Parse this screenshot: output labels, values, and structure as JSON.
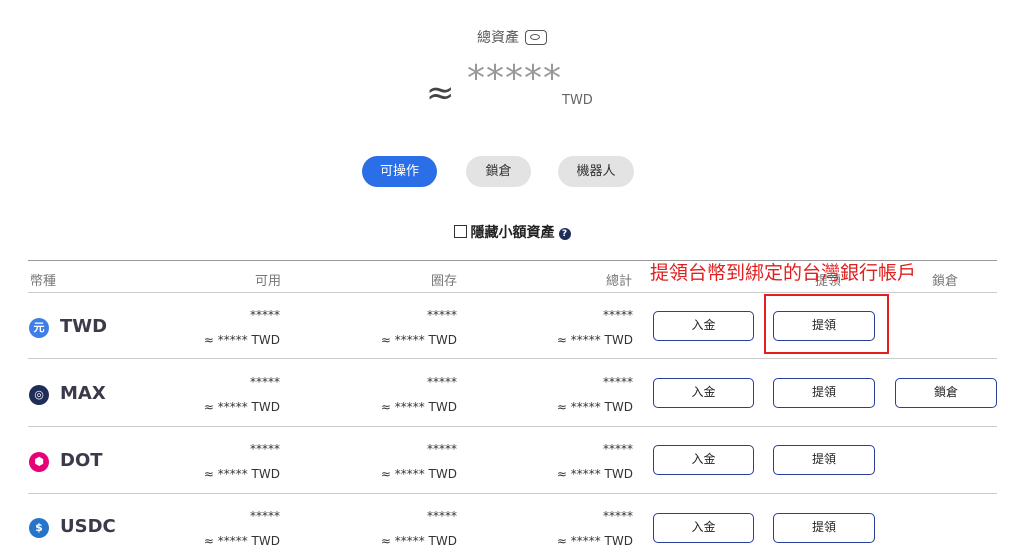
{
  "summary": {
    "total_label": "總資產",
    "approx": "≈",
    "total_value": "*****",
    "currency": "TWD"
  },
  "tabs": [
    {
      "label": "可操作",
      "active": true
    },
    {
      "label": "鎖倉",
      "active": false
    },
    {
      "label": "機器人",
      "active": false
    }
  ],
  "filter": {
    "hide_small_label": "隱藏小額資產",
    "help_glyph": "?"
  },
  "table": {
    "headers": {
      "currency": "幣種",
      "available": "可用",
      "locked": "圈存",
      "total": "總計",
      "withdraw": "提領",
      "lock": "鎖倉"
    },
    "rows": [
      {
        "coin": "TWD",
        "icon_glyph": "元",
        "icon": "twd-coin-icon",
        "color": "#3f7de8",
        "available": "*****",
        "available_twd": "≈ ***** TWD",
        "locked": "*****",
        "locked_twd": "≈ ***** TWD",
        "total": "*****",
        "total_twd": "≈ ***** TWD",
        "deposit": "入金",
        "withdraw": "提領"
      },
      {
        "coin": "MAX",
        "icon_glyph": "◎",
        "icon": "max-coin-icon",
        "color": "#1f2d5a",
        "available": "*****",
        "available_twd": "≈ ***** TWD",
        "locked": "*****",
        "locked_twd": "≈ ***** TWD",
        "total": "*****",
        "total_twd": "≈ ***** TWD",
        "deposit": "入金",
        "withdraw": "提領",
        "lock": "鎖倉"
      },
      {
        "coin": "DOT",
        "icon_glyph": "⬢",
        "icon": "dot-coin-icon",
        "color": "#e6007a",
        "available": "*****",
        "available_twd": "≈ ***** TWD",
        "locked": "*****",
        "locked_twd": "≈ ***** TWD",
        "total": "*****",
        "total_twd": "≈ ***** TWD",
        "deposit": "入金",
        "withdraw": "提領"
      },
      {
        "coin": "USDC",
        "icon_glyph": "$",
        "icon": "usdc-coin-icon",
        "color": "#2775ca",
        "available": "*****",
        "available_twd": "≈ ***** TWD",
        "locked": "*****",
        "locked_twd": "≈ ***** TWD",
        "total": "*****",
        "total_twd": "≈ ***** TWD",
        "deposit": "入金",
        "withdraw": "提領"
      }
    ]
  },
  "annotation": {
    "text": "提領台幣到綁定的台灣銀行帳戶",
    "color": "#e02020"
  }
}
